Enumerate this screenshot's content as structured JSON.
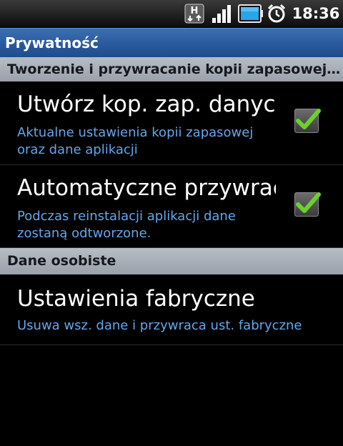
{
  "status_bar": {
    "time": "18:36",
    "network_type": "H",
    "icons": [
      "hsdpa-data-icon",
      "signal-strength-icon",
      "battery-icon",
      "alarm-clock-icon"
    ],
    "colors": {
      "battery_fill": "#27a6e6"
    }
  },
  "title": "Prywatność",
  "sections": {
    "backup": {
      "header": "Tworzenie i przywracanie kopii zapasowej tel...",
      "items": [
        {
          "title": "Utwórz kop. zap. danych",
          "summary": "Aktualne ustawienia kopii zapasowej oraz dane aplikacji",
          "checked": true
        },
        {
          "title": "Automatyczne przywraca",
          "summary": "Podczas reinstalacji aplikacji dane zostaną odtworzone.",
          "checked": true
        }
      ]
    },
    "personal": {
      "header": "Dane osobiste",
      "items": [
        {
          "title": "Ustawienia fabryczne",
          "summary": "Usuwa wsz. dane i przywraca ust. fabryczne"
        }
      ]
    }
  },
  "colors": {
    "title_bar": "#2a5a9e",
    "summary_text": "#62a7ec",
    "section_header": "#a9afb8",
    "check_mark": "#6cd12a"
  }
}
